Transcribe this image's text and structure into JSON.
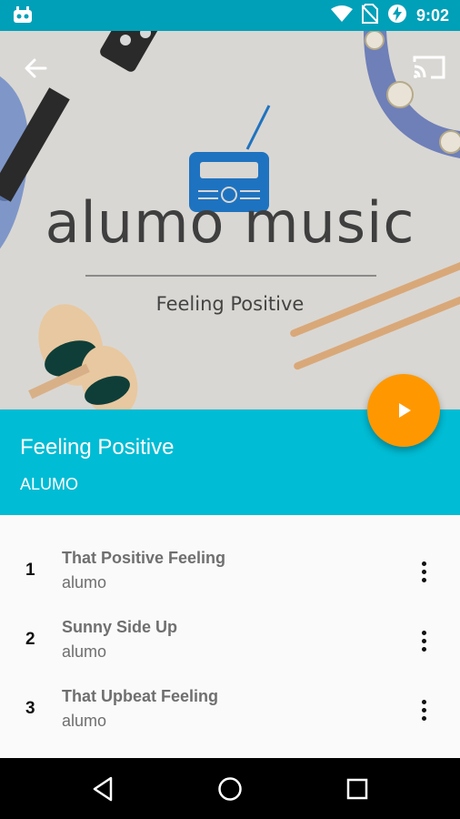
{
  "status_bar": {
    "time": "9:02",
    "icons": [
      "app-notification-icon",
      "wifi-icon",
      "no-sim-icon",
      "battery-charging-icon"
    ]
  },
  "header": {
    "back_icon": "back-arrow-icon",
    "cast_icon": "cast-icon",
    "art": {
      "brand": "alumo music",
      "subtitle": "Feeling Positive"
    }
  },
  "album": {
    "title": "Feeling Positive",
    "artist": "ALUMO",
    "play_icon": "play-icon"
  },
  "tracks": [
    {
      "number": "1",
      "title": "That Positive Feeling",
      "artist": "alumo"
    },
    {
      "number": "2",
      "title": "Sunny Side Up",
      "artist": "alumo"
    },
    {
      "number": "3",
      "title": "That Upbeat Feeling",
      "artist": "alumo"
    }
  ],
  "nav_bar": {
    "icons": [
      "back-icon",
      "home-icon",
      "recents-icon"
    ]
  },
  "colors": {
    "status_bar": "#00a0b8",
    "accent": "#00bcd4",
    "fab": "#ff9800",
    "radio_blue": "#1e73c0"
  }
}
